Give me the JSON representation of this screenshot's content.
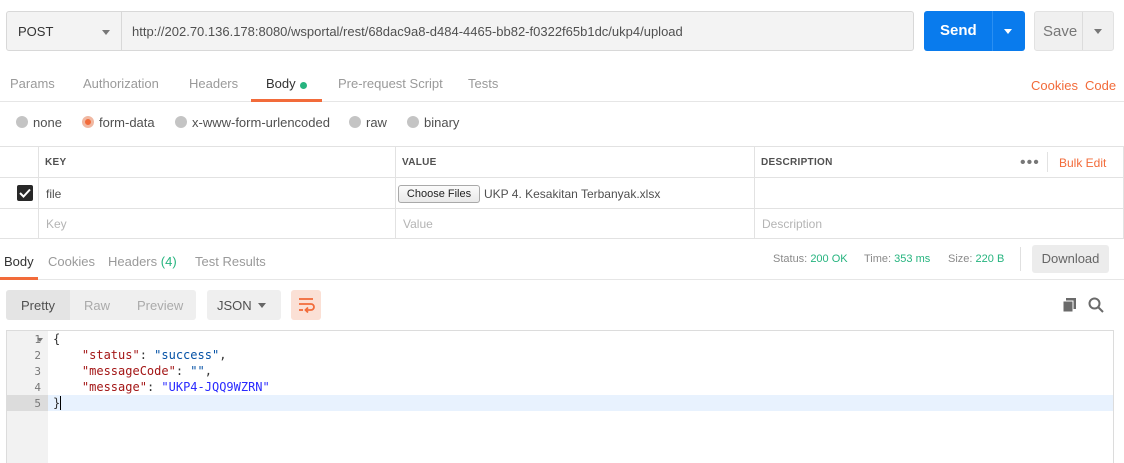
{
  "request": {
    "method": "POST",
    "url": "http://202.70.136.178:8080/wsportal/rest/68dac9a8-d484-4465-bb82-f0322f65b1dc/ukp4/upload",
    "send_label": "Send",
    "save_label": "Save"
  },
  "tabs": {
    "params": "Params",
    "authorization": "Authorization",
    "headers": "Headers",
    "body": "Body",
    "prerequest": "Pre-request Script",
    "tests": "Tests",
    "cookies": "Cookies",
    "code": "Code"
  },
  "body_types": {
    "none": "none",
    "form_data": "form-data",
    "urlencoded": "x-www-form-urlencoded",
    "raw": "raw",
    "binary": "binary",
    "selected": "form-data"
  },
  "params_table": {
    "headers": {
      "key": "KEY",
      "value": "VALUE",
      "description": "DESCRIPTION"
    },
    "more": "•••",
    "bulk_edit": "Bulk Edit",
    "row": {
      "key": "file",
      "choose_label": "Choose Files",
      "file_name": "UKP 4. Kesakitan Terbanyak.xlsx",
      "checked": true
    },
    "placeholders": {
      "key": "Key",
      "value": "Value",
      "description": "Description"
    }
  },
  "response": {
    "tabs": {
      "body": "Body",
      "cookies": "Cookies",
      "headers": "Headers",
      "headers_count": "(4)",
      "tests": "Test Results"
    },
    "status_label": "Status:",
    "status_value": "200 OK",
    "time_label": "Time:",
    "time_value": "353 ms",
    "size_label": "Size:",
    "size_value": "220 B",
    "download_label": "Download",
    "view": {
      "pretty": "Pretty",
      "raw": "Raw",
      "preview": "Preview",
      "format": "JSON"
    },
    "lines": [
      "1",
      "2",
      "3",
      "4",
      "5"
    ],
    "code": {
      "open": "{",
      "status_key": "\"status\"",
      "status_val": "\"success\"",
      "mc_key": "\"messageCode\"",
      "mc_val": "\"\"",
      "msg_key": "\"message\"",
      "msg_val": "\"UKP4-JQQ9WZRN\"",
      "close": "}"
    }
  },
  "colors": {
    "accent": "#f26b3a",
    "send": "#097bed",
    "success": "#26b47f"
  }
}
